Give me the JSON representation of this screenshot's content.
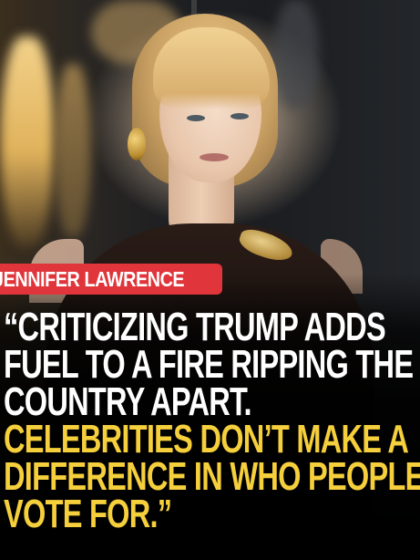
{
  "name_tag": "JENNIFER LAWRENCE",
  "quote": {
    "white_lines": [
      "“CRITICIZING TRUMP ADDS",
      "FUEL TO A FIRE RIPPING THE",
      "COUNTRY APART."
    ],
    "yellow_lines": [
      "CELEBRITIES DON’T MAKE A",
      "DIFFERENCE IN WHO PEOPLE",
      "VOTE FOR.”"
    ]
  },
  "colors": {
    "tag_background": "#e0353a",
    "quote_white": "#ffffff",
    "quote_highlight": "#f5cf3c",
    "background": "#000000"
  }
}
